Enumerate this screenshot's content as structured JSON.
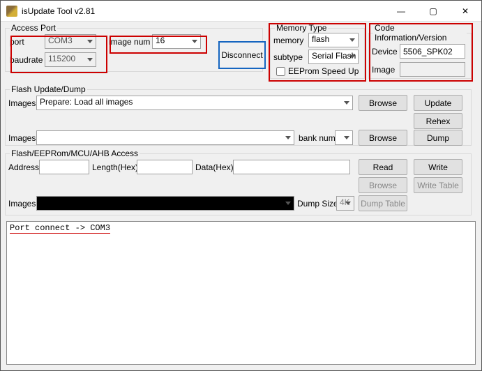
{
  "window": {
    "title": "isUpdate Tool v2.81"
  },
  "titlebar": {
    "min": "—",
    "max": "▢",
    "close": "✕"
  },
  "accessPort": {
    "legend": "Access Port",
    "portLabel": "port",
    "portValue": "COM3",
    "baudLabel": "baudrate",
    "baudValue": "115200",
    "imageNumLabel": "image num",
    "imageNumValue": "16",
    "disconnect": "Disconnect"
  },
  "memoryType": {
    "legend": "Memory Type",
    "memoryLabel": "memory",
    "memoryValue": "flash",
    "subtypeLabel": "subtype",
    "subtypeValue": "Serial Flash",
    "eepromSpeedUp": "EEProm Speed Up"
  },
  "codeInfo": {
    "legend": "Code Information/Version",
    "deviceLabel": "Device",
    "deviceValue": "5506_SPK02",
    "imageLabel": "Image",
    "imageValue": ""
  },
  "flashUpdate": {
    "legend": "Flash Update/Dump",
    "imagesLabel1": "Images",
    "imagesValue1": "Prepare: Load all images",
    "browse1": "Browse",
    "update": "Update",
    "rehex": "Rehex",
    "imagesLabel2": "Images",
    "imagesValue2": "",
    "bankNumLabel": "bank num",
    "bankNumValue": "",
    "browse2": "Browse",
    "dump": "Dump"
  },
  "flashAccess": {
    "legend": "Flash/EEPRom/MCU/AHB Access",
    "addressLabel": "Address",
    "addressValue": "",
    "lengthLabel": "Length(Hex)",
    "lengthValue": "",
    "dataLabel": "Data(Hex)",
    "dataValue": "",
    "read": "Read",
    "write": "Write",
    "browse": "Browse",
    "writeTable": "Write Table",
    "imagesLabel": "Images",
    "imagesValue": "",
    "dumpSizeLabel": "Dump Size",
    "dumpSizeValue": "4K",
    "dumpTable": "Dump Table"
  },
  "console": {
    "line1": "Port connect -> COM3"
  }
}
